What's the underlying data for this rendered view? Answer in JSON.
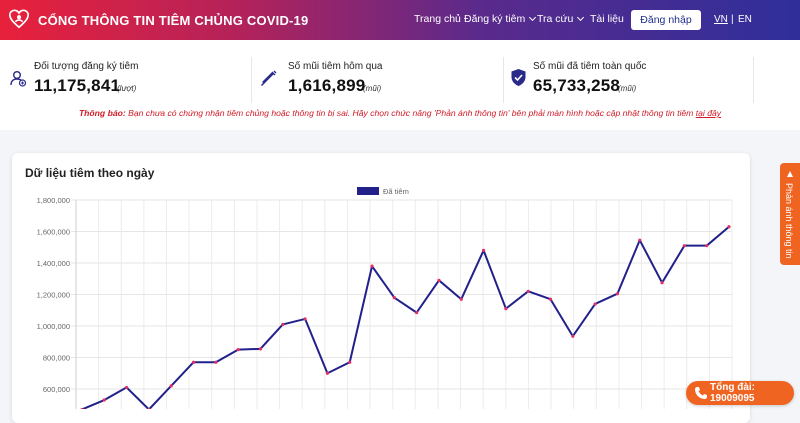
{
  "header": {
    "title": "CỔNG THÔNG TIN TIÊM CHỦNG COVID-19",
    "nav": {
      "home": "Trang chủ",
      "register": "Đăng ký tiêm",
      "lookup": "Tra cứu",
      "docs": "Tài liệu"
    },
    "login_label": "Đăng nhập",
    "lang_vn": "VN",
    "lang_sep": "|",
    "lang_en": "EN"
  },
  "stats": [
    {
      "label": "Đối tượng đăng ký tiêm",
      "value": "11,175,841",
      "unit": "(lượt)",
      "icon": "user-add-icon"
    },
    {
      "label": "Số mũi tiêm hôm qua",
      "value": "1,616,899",
      "unit": "(mũi)",
      "icon": "syringe-icon"
    },
    {
      "label": "Số mũi đã tiêm toàn quốc",
      "value": "65,733,258",
      "unit": "(mũi)",
      "icon": "shield-check-icon"
    }
  ],
  "notice": {
    "prefix": "Thông báo:",
    "text": " Bạn chưa có chứng nhận tiêm chủng hoặc thông tin bị sai. Hãy chọn chức năng 'Phản ánh thông tin' bên phải màn hình hoặc cập nhật thông tin tiêm ",
    "link": "tại đây"
  },
  "chart_section": {
    "title": "Dữ liệu tiêm theo ngày"
  },
  "chart_data": {
    "type": "line",
    "legend": "Đã tiêm",
    "legend_position": "top",
    "grid": true,
    "y_ticks": [
      "1,800,000",
      "1,600,000",
      "1,400,000",
      "1,200,000",
      "1,000,000",
      "800,000",
      "600,000"
    ],
    "ylim": [
      600000,
      1800000
    ],
    "series": [
      {
        "name": "Đã tiêm",
        "values": [
          470000,
          530000,
          610000,
          470000,
          620000,
          770000,
          770000,
          850000,
          855000,
          1010000,
          1045000,
          700000,
          770000,
          1380000,
          1180000,
          1085000,
          1290000,
          1170000,
          1480000,
          1110000,
          1220000,
          1170000,
          935000,
          1140000,
          1205000,
          1545000,
          1275000,
          1510000,
          1510000,
          1630000
        ]
      }
    ],
    "colors": {
      "line": "#22208a",
      "point": "#e0306a",
      "legend_box": "#22208a"
    }
  },
  "side_tab": {
    "label": "Phản ánh thông tin",
    "icon": "feedback-icon"
  },
  "hotline": {
    "label": "Tổng đài: 19009095",
    "icon": "phone-icon"
  },
  "colors": {
    "accent_red": "#e8213b",
    "accent_blue": "#2f2f9a",
    "orange": "#f06421"
  }
}
